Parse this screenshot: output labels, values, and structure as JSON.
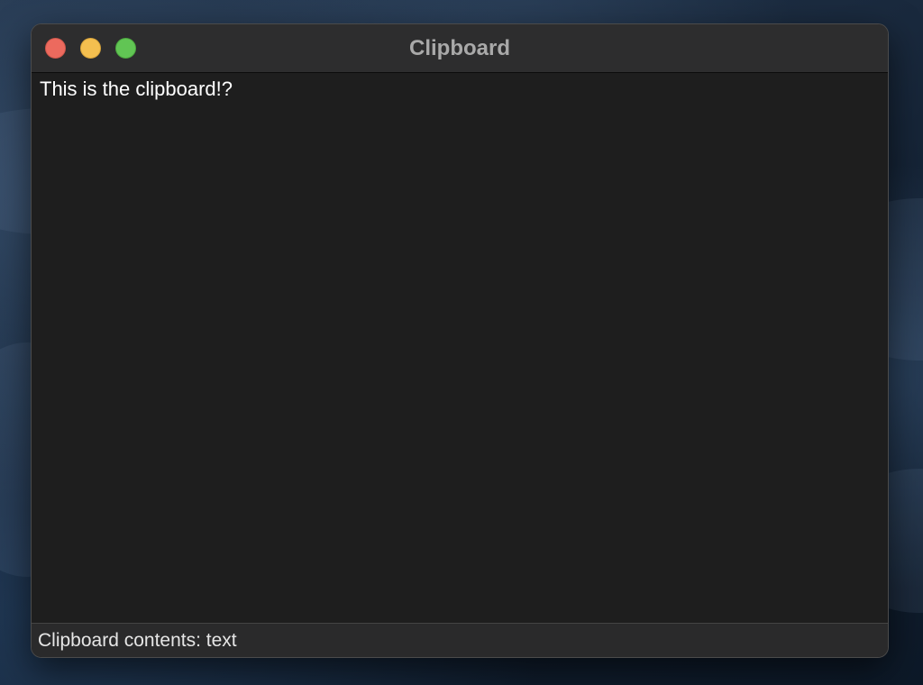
{
  "window": {
    "title": "Clipboard"
  },
  "content": {
    "text": "This is the clipboard!?"
  },
  "status_bar": {
    "text": "Clipboard contents: text"
  },
  "colors": {
    "close": "#ec6a5e",
    "minimize": "#f4bf4f",
    "zoom": "#61c554",
    "window_background": "#1e1e1e",
    "titlebar_background": "#2d2d2e"
  }
}
